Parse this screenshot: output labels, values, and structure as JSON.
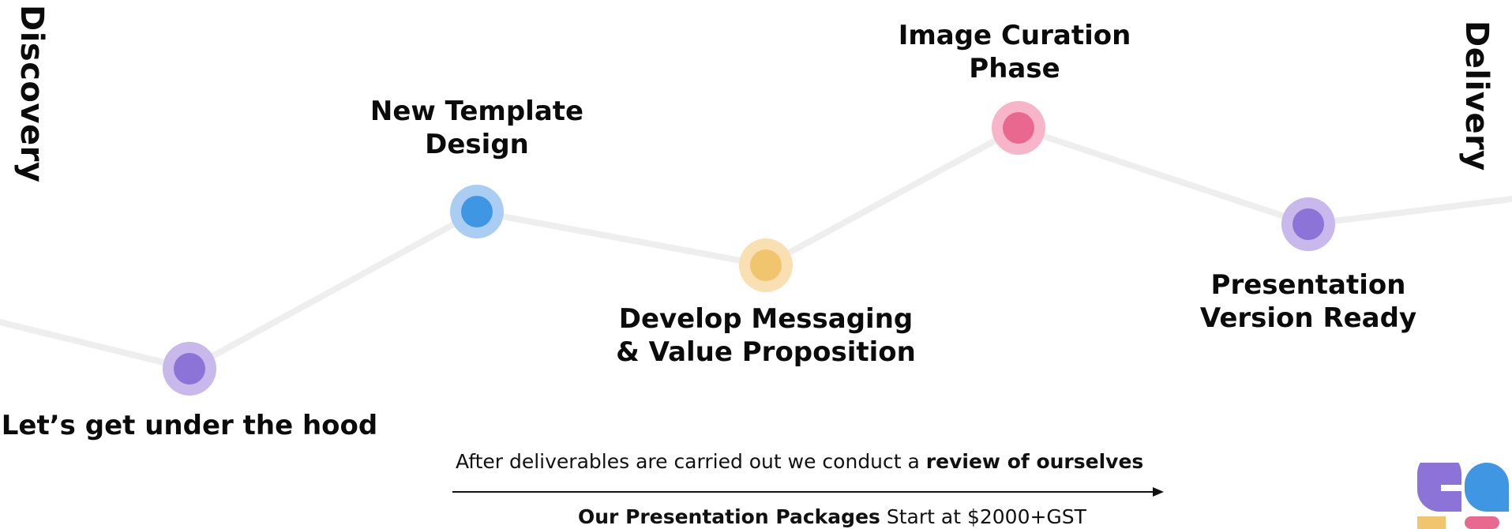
{
  "side_labels": {
    "left": "Discovery",
    "right": "Delivery"
  },
  "milestones": [
    {
      "id": "m1",
      "line1": "Let’s get under the hood",
      "line2": "",
      "outer": "#c8b8ec",
      "inner": "#8b73d8"
    },
    {
      "id": "m2",
      "line1": "New Template",
      "line2": "Design",
      "outer": "#a9cdf3",
      "inner": "#3f96e3"
    },
    {
      "id": "m3",
      "line1": "Develop Messaging",
      "line2": "& Value Proposition",
      "outer": "#f8e0b2",
      "inner": "#f1c46e"
    },
    {
      "id": "m4",
      "line1": "Image Curation",
      "line2": "Phase",
      "outer": "#f6b5c9",
      "inner": "#e8688f"
    },
    {
      "id": "m5",
      "line1": "Presentation",
      "line2": "Version Ready",
      "outer": "#c8b8ec",
      "inner": "#8b73d8"
    }
  ],
  "footer": {
    "review_prefix": "After deliverables are carried out we conduct a ",
    "review_bold": "review of ourselves",
    "packages_bold": "Our Presentation Packages",
    "packages_rest": " Start at $2000+GST"
  },
  "colors": {
    "line": "#eeeeee",
    "arrow": "#111111",
    "logo_purple": "#8b73d8",
    "logo_blue": "#3f96e3",
    "logo_yellow": "#f1c46e",
    "logo_pink": "#e8688f"
  },
  "icons": {
    "logo": "brand-logo-icon"
  }
}
